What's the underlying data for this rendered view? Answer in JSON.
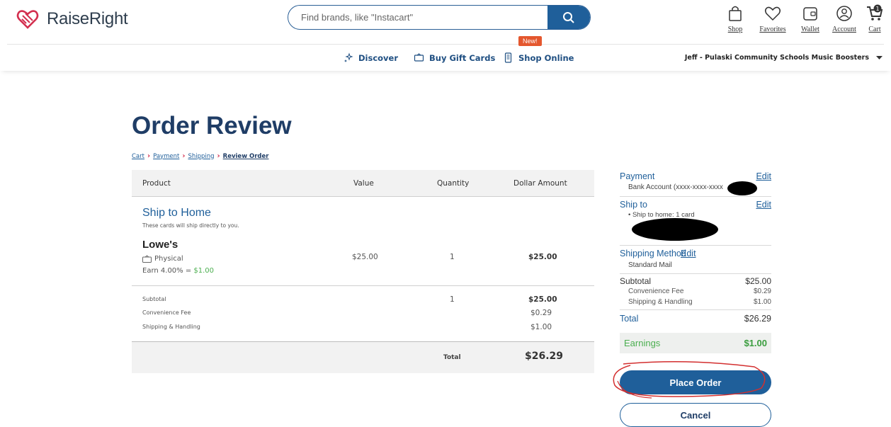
{
  "header": {
    "logo_text": "RaiseRight",
    "search_placeholder": "Find brands, like \"Instacart\"",
    "icons": [
      {
        "label": "Shop",
        "icon": "shopping-bag-icon"
      },
      {
        "label": "Favorites",
        "icon": "heart-icon"
      },
      {
        "label": "Wallet",
        "icon": "wallet-icon"
      },
      {
        "label": "Account",
        "icon": "account-icon"
      },
      {
        "label": "Cart",
        "icon": "cart-icon",
        "badge": "1"
      }
    ]
  },
  "nav": {
    "new_badge": "New!",
    "items": [
      {
        "label": "Discover",
        "icon": "sparkle-icon"
      },
      {
        "label": "Buy Gift Cards",
        "icon": "gift-card-icon"
      },
      {
        "label": "Shop Online",
        "icon": "phone-icon"
      }
    ],
    "organization": "Jeff - Pulaski Community Schools Music Boosters"
  },
  "page": {
    "title": "Order Review",
    "breadcrumb": [
      "Cart",
      "Payment",
      "Shipping",
      "Review Order"
    ]
  },
  "table": {
    "headers": {
      "product": "Product",
      "value": "Value",
      "quantity": "Quantity",
      "dollar_amount": "Dollar Amount"
    },
    "section_title": "Ship to Home",
    "section_subtitle": "These cards will ship directly to you.",
    "product": {
      "name": "Lowe's",
      "type": "Physical",
      "earn_prefix": "Earn 4.00% = ",
      "earn_amount": "$1.00",
      "value": "$25.00",
      "quantity": "1",
      "amount": "$25.00"
    },
    "summary": {
      "subtotal_label": "Subtotal",
      "subtotal_qty": "1",
      "subtotal": "$25.00",
      "fee_label": "Convenience Fee",
      "fee": "$0.29",
      "shipping_label": "Shipping & Handling",
      "shipping": "$1.00",
      "total_label": "Total",
      "total": "$26.29"
    }
  },
  "sidebar": {
    "payment_title": "Payment",
    "payment_detail": "Bank Account (xxxx-xxxx-xxxx",
    "ship_title": "Ship to",
    "ship_detail": "• Ship to home: 1 card",
    "method_title": "Shipping Method",
    "method_detail": "Standard Mail",
    "edit_label": "Edit",
    "subtotal_label": "Subtotal",
    "subtotal": "$25.00",
    "fee_label": "Convenience Fee",
    "fee": "$0.29",
    "shipping_label": "Shipping & Handling",
    "shipping": "$1.00",
    "total_label": "Total",
    "total": "$26.29",
    "earnings_label": "Earnings",
    "earnings": "$1.00",
    "place_order": "Place Order",
    "cancel": "Cancel"
  },
  "colors": {
    "brand_blue": "#1f5f9a",
    "heading_navy": "#1f3d66",
    "earn_green": "#4caf50",
    "logo_red": "#d32f4f",
    "annotation_red": "#d32f2f"
  }
}
